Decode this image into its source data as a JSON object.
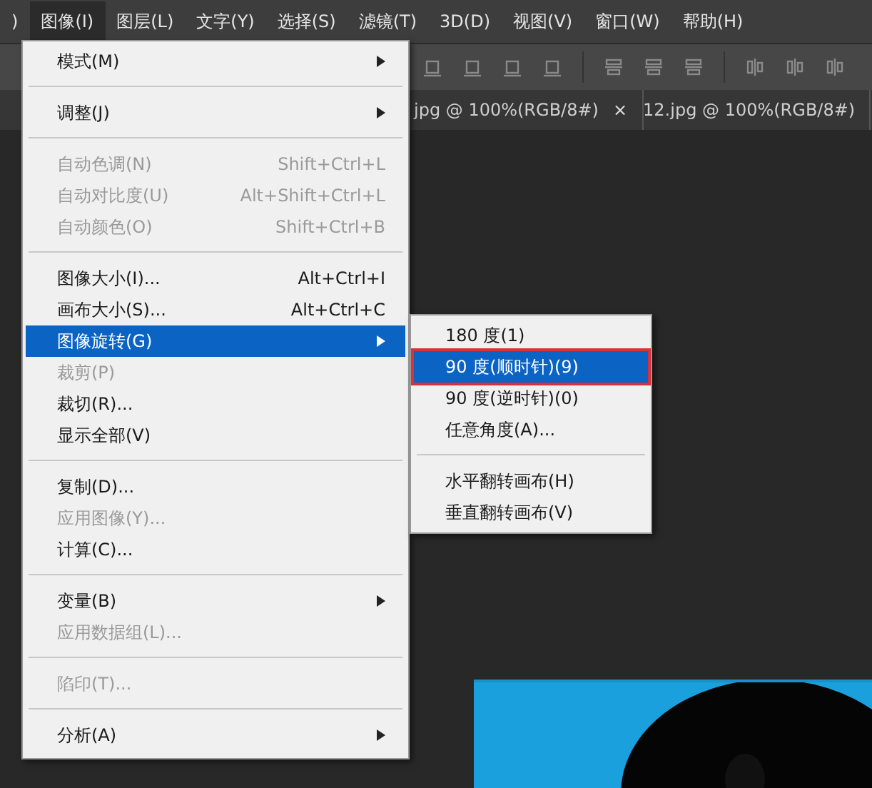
{
  "menubar": [
    {
      "label": ")",
      "selected": false
    },
    {
      "label": "图像(I)",
      "selected": true
    },
    {
      "label": "图层(L)",
      "selected": false
    },
    {
      "label": "文字(Y)",
      "selected": false
    },
    {
      "label": "选择(S)",
      "selected": false
    },
    {
      "label": "滤镜(T)",
      "selected": false
    },
    {
      "label": "3D(D)",
      "selected": false
    },
    {
      "label": "视图(V)",
      "selected": false
    },
    {
      "label": "窗口(W)",
      "selected": false
    },
    {
      "label": "帮助(H)",
      "selected": false
    }
  ],
  "tabs": [
    {
      "label": "jpg @ 100%(RGB/8#)",
      "close": "×"
    },
    {
      "label": "12.jpg @ 100%(RGB/8#)"
    }
  ],
  "menu": [
    {
      "kind": "item",
      "label": "模式(M)",
      "submenu": true,
      "disabled": false,
      "selected": false
    },
    {
      "kind": "separator"
    },
    {
      "kind": "item",
      "label": "调整(J)",
      "submenu": true,
      "disabled": false,
      "selected": false
    },
    {
      "kind": "separator"
    },
    {
      "kind": "item",
      "label": "自动色调(N)",
      "shortcut": "Shift+Ctrl+L",
      "disabled": true,
      "selected": false
    },
    {
      "kind": "item",
      "label": "自动对比度(U)",
      "shortcut": "Alt+Shift+Ctrl+L",
      "disabled": true,
      "selected": false
    },
    {
      "kind": "item",
      "label": "自动颜色(O)",
      "shortcut": "Shift+Ctrl+B",
      "disabled": true,
      "selected": false
    },
    {
      "kind": "separator"
    },
    {
      "kind": "item",
      "label": "图像大小(I)...",
      "shortcut": "Alt+Ctrl+I",
      "disabled": false,
      "selected": false
    },
    {
      "kind": "item",
      "label": "画布大小(S)...",
      "shortcut": "Alt+Ctrl+C",
      "disabled": false,
      "selected": false
    },
    {
      "kind": "item",
      "label": "图像旋转(G)",
      "submenu": true,
      "disabled": false,
      "selected": true
    },
    {
      "kind": "item",
      "label": "裁剪(P)",
      "disabled": true,
      "selected": false
    },
    {
      "kind": "item",
      "label": "裁切(R)...",
      "disabled": false,
      "selected": false
    },
    {
      "kind": "item",
      "label": "显示全部(V)",
      "disabled": false,
      "selected": false
    },
    {
      "kind": "separator"
    },
    {
      "kind": "item",
      "label": "复制(D)...",
      "disabled": false,
      "selected": false
    },
    {
      "kind": "item",
      "label": "应用图像(Y)...",
      "disabled": true,
      "selected": false
    },
    {
      "kind": "item",
      "label": "计算(C)...",
      "disabled": false,
      "selected": false
    },
    {
      "kind": "separator"
    },
    {
      "kind": "item",
      "label": "变量(B)",
      "submenu": true,
      "disabled": false,
      "selected": false
    },
    {
      "kind": "item",
      "label": "应用数据组(L)...",
      "disabled": true,
      "selected": false
    },
    {
      "kind": "separator"
    },
    {
      "kind": "item",
      "label": "陷印(T)...",
      "disabled": true,
      "selected": false
    },
    {
      "kind": "separator"
    },
    {
      "kind": "item",
      "label": "分析(A)",
      "submenu": true,
      "disabled": false,
      "selected": false
    }
  ],
  "submenu": [
    {
      "kind": "item",
      "label": "180 度(1)",
      "selected": false,
      "highlighted": false
    },
    {
      "kind": "item",
      "label": "90 度(顺时针)(9)",
      "selected": true,
      "highlighted": true
    },
    {
      "kind": "item",
      "label": "90 度(逆时针)(0)",
      "selected": false,
      "highlighted": false
    },
    {
      "kind": "item",
      "label": "任意角度(A)...",
      "selected": false,
      "highlighted": false
    },
    {
      "kind": "separator"
    },
    {
      "kind": "item",
      "label": "水平翻转画布(H)",
      "selected": false,
      "highlighted": false
    },
    {
      "kind": "item",
      "label": "垂直翻转画布(V)",
      "selected": false,
      "highlighted": false
    }
  ]
}
